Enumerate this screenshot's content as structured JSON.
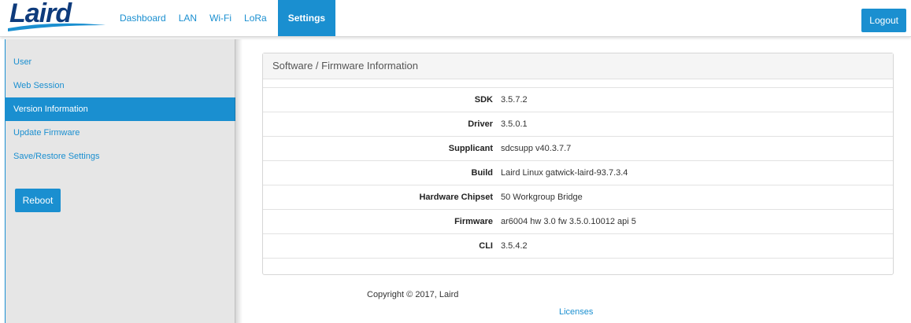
{
  "brand": {
    "logo_text": "Laird",
    "logo_color": "#0e3b7c",
    "accent": "#1a8fd0"
  },
  "nav": {
    "items": [
      {
        "label": "Dashboard",
        "active": false
      },
      {
        "label": "LAN",
        "active": false
      },
      {
        "label": "Wi-Fi",
        "active": false
      },
      {
        "label": "LoRa",
        "active": false
      },
      {
        "label": "Settings",
        "active": true
      }
    ],
    "logout_label": "Logout"
  },
  "sidebar": {
    "items": [
      {
        "label": "User",
        "active": false
      },
      {
        "label": "Web Session",
        "active": false
      },
      {
        "label": "Version Information",
        "active": true
      },
      {
        "label": "Update Firmware",
        "active": false
      },
      {
        "label": "Save/Restore Settings",
        "active": false
      }
    ],
    "reboot_label": "Reboot"
  },
  "panel": {
    "title": "Software / Firmware Information",
    "rows": [
      {
        "label": "SDK",
        "value": "3.5.7.2"
      },
      {
        "label": "Driver",
        "value": "3.5.0.1"
      },
      {
        "label": "Supplicant",
        "value": "sdcsupp v40.3.7.7"
      },
      {
        "label": "Build",
        "value": "Laird Linux gatwick-laird-93.7.3.4"
      },
      {
        "label": "Hardware Chipset",
        "value": "50 Workgroup Bridge"
      },
      {
        "label": "Firmware",
        "value": "ar6004 hw 3.0 fw 3.5.0.10012 api 5"
      },
      {
        "label": "CLI",
        "value": "3.5.4.2"
      }
    ]
  },
  "footer": {
    "copyright_symbol": "©",
    "copyright_text": "2017, Laird",
    "copyright_prefix": "Copyright",
    "licenses_label": "Licenses"
  }
}
